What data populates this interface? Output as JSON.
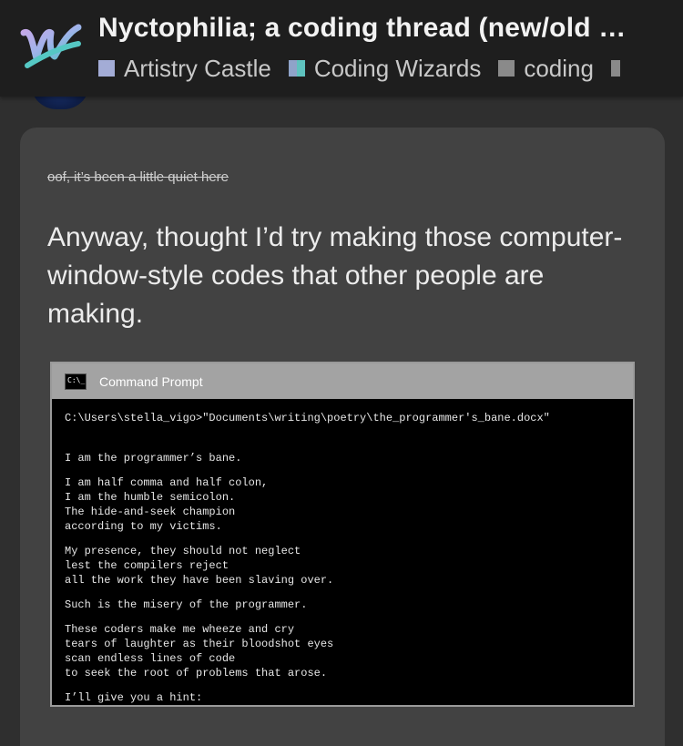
{
  "header": {
    "title": "Nyctophilia; a coding thread (new/old …",
    "categories": [
      {
        "name": "Artistry Castle",
        "color": "#a3acd6"
      },
      {
        "name": "Coding Wizards",
        "color_left": "#8fa3c9",
        "color_right": "#5ec2be"
      },
      {
        "name": "coding",
        "color": "#8a8a8a"
      },
      {
        "name": "",
        "color": "#8a8a8a"
      }
    ]
  },
  "post": {
    "struck_text": "oof, it’s been a little quiet here",
    "body_text": "Anyway, thought I’d try making those computer-window-style codes that other people are making."
  },
  "cmd": {
    "title": "Command Prompt",
    "icon_text": "C:\\_",
    "path": "C:\\Users\\stella_vigo>\"Documents\\writing\\poetry\\the_programmer's_bane.docx\"",
    "stanzas": [
      [
        "I am the programmer’s bane."
      ],
      [
        "I am half comma and half colon,",
        "I am the humble semicolon.",
        "The hide-and-seek champion",
        "according to my victims."
      ],
      [
        "My presence, they should not neglect",
        "lest the compilers reject",
        "all the work they have been slaving over."
      ],
      [
        "Such is the misery of the programmer."
      ],
      [
        "These coders make me wheeze and cry",
        "tears of laughter as their bloodshot eyes",
        "scan endless lines of code",
        "to seek the root of problems that arose."
      ],
      [
        "I’ll give you a hint:"
      ]
    ]
  }
}
